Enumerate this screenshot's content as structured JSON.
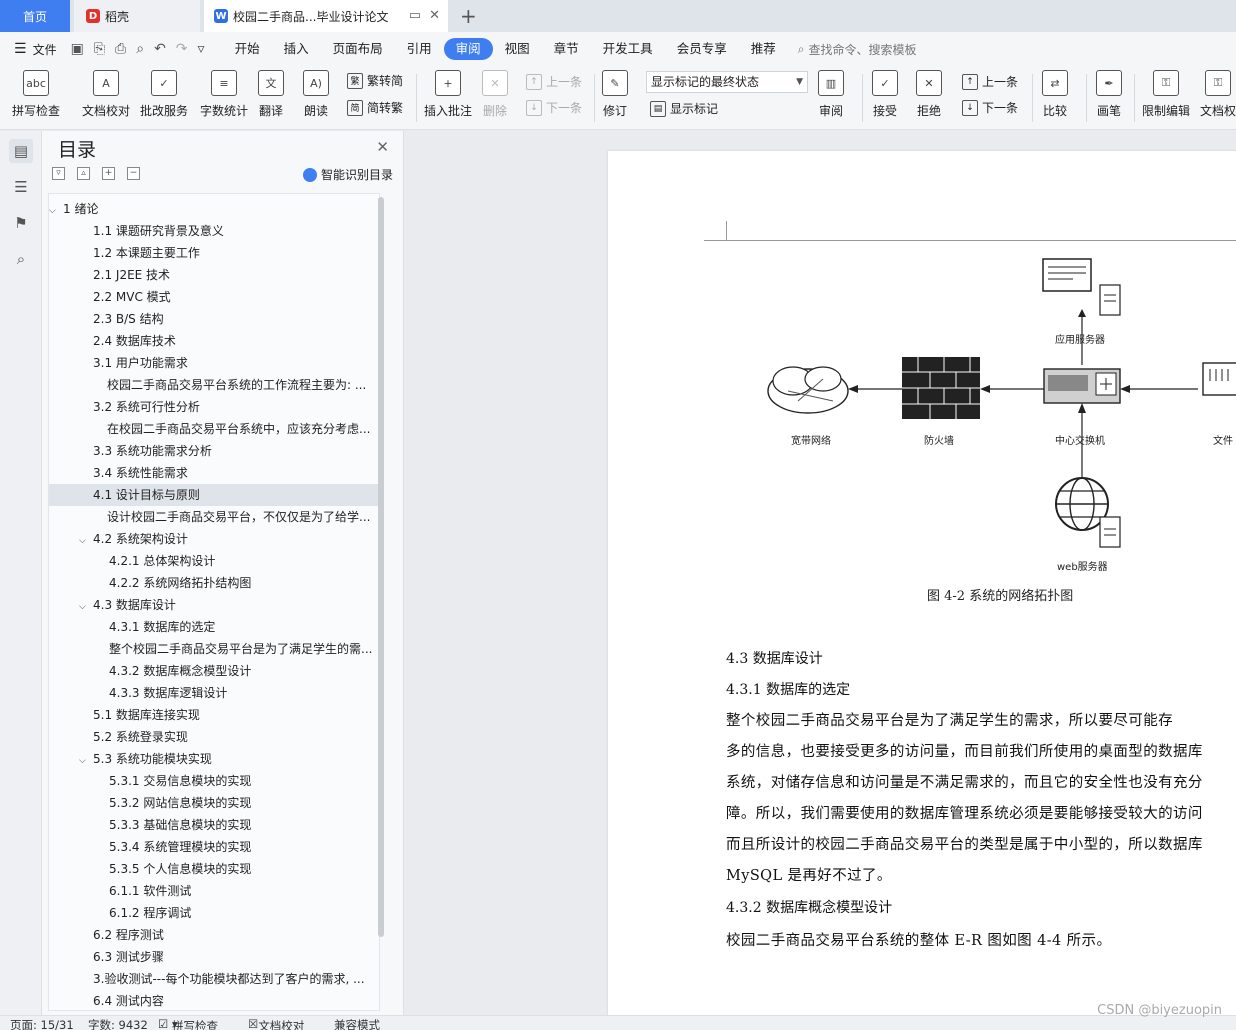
{
  "tabs": {
    "home": "首页",
    "doc1": "稻壳",
    "doc2": "校园二手商品...毕业设计论文",
    "doc2_icon": "W",
    "doc1_icon": "D"
  },
  "menubar": {
    "file": "文件",
    "tabs": [
      "开始",
      "插入",
      "页面布局",
      "引用",
      "审阅",
      "视图",
      "章节",
      "开发工具",
      "会员专享",
      "推荐"
    ],
    "search": "查找命令、搜索模板"
  },
  "ribbon": {
    "spell_check": "拼写检查",
    "doc_proof": "文档校对",
    "batch_service": "批改服务",
    "word_count": "字数统计",
    "translate": "翻译",
    "read_aloud": "朗读",
    "trad_to_simp": "繁转简",
    "simp_to_trad": "简转繁",
    "insert_comment": "插入批注",
    "delete": "删除",
    "prev_comment": "上一条",
    "next_comment": "下一条",
    "track_changes": "修订",
    "show_marks_select": "显示标记的最终状态",
    "show_marks": "显示标记",
    "review": "审阅",
    "accept": "接受",
    "reject": "拒绝",
    "prev_change": "上一条",
    "next_change": "下一条",
    "compare": "比较",
    "pen": "画笔",
    "restrict_edit": "限制编辑",
    "doc_perm": "文档权"
  },
  "toc": {
    "title": "目录",
    "smart": "智能识别目录",
    "items": [
      {
        "text": "1  绪论",
        "level": 0,
        "caret": "v"
      },
      {
        "text": "1.1  课题研究背景及意义",
        "level": 1
      },
      {
        "text": "1.2  本课题主要工作",
        "level": 1
      },
      {
        "text": "2.1  J2EE 技术",
        "level": 1
      },
      {
        "text": "2.2  MVC 模式",
        "level": 1
      },
      {
        "text": "2.3  B/S 结构",
        "level": 1
      },
      {
        "text": "2.4  数据库技术",
        "level": 1
      },
      {
        "text": "3.1  用户功能需求",
        "level": 1
      },
      {
        "text": "校园二手商品交易平台系统的工作流程主要为: ...",
        "level": 2
      },
      {
        "text": "3.2  系统可行性分析",
        "level": 1
      },
      {
        "text": "在校园二手商品交易平台系统中，应该充分考虑...",
        "level": 2
      },
      {
        "text": "3.3  系统功能需求分析",
        "level": 1
      },
      {
        "text": "3.4  系统性能需求",
        "level": 1
      },
      {
        "text": "4.1  设计目标与原则",
        "level": 1,
        "selected": true
      },
      {
        "text": "设计校园二手商品交易平台，不仅仅是为了给学...",
        "level": 2
      },
      {
        "text": "4.2  系统架构设计",
        "level": 1,
        "caret": "v"
      },
      {
        "text": "4.2.1  总体架构设计",
        "level": 3
      },
      {
        "text": "4.2.2  系统网络拓扑结构图",
        "level": 3
      },
      {
        "text": "4.3  数据库设计",
        "level": 1,
        "caret": "v"
      },
      {
        "text": "4.3.1  数据库的选定",
        "level": 3
      },
      {
        "text": "整个校园二手商品交易平台是为了满足学生的需...",
        "level": 3
      },
      {
        "text": "4.3.2  数据库概念模型设计",
        "level": 3
      },
      {
        "text": "4.3.3  数据库逻辑设计",
        "level": 3
      },
      {
        "text": "5.1  数据库连接实现",
        "level": 1
      },
      {
        "text": "5.2  系统登录实现",
        "level": 1
      },
      {
        "text": "5.3  系统功能模块实现",
        "level": 1,
        "caret": "v"
      },
      {
        "text": "5.3.1  交易信息模块的实现",
        "level": 3
      },
      {
        "text": "5.3.2  网站信息模块的实现",
        "level": 3
      },
      {
        "text": "5.3.3  基础信息模块的实现",
        "level": 3
      },
      {
        "text": "5.3.4  系统管理模块的实现",
        "level": 3
      },
      {
        "text": "5.3.5  个人信息模块的实现",
        "level": 3
      },
      {
        "text": "6.1.1  软件测试",
        "level": 3
      },
      {
        "text": "6.1.2  程序调试",
        "level": 3
      },
      {
        "text": "6.2  程序测试",
        "level": 1
      },
      {
        "text": "6.3  测试步骤",
        "level": 1
      },
      {
        "text": "3.验收测试---每个功能模块都达到了客户的需求, ...",
        "level": 1
      },
      {
        "text": "6.4  测试内容",
        "level": 1
      }
    ]
  },
  "figure": {
    "app_server": "应用服务器",
    "broadband": "宽带网络",
    "firewall": "防火墙",
    "core_switch": "中心交换机",
    "file_partial": "文件",
    "web_server": "web服务器",
    "caption": "图 4-2 系统的网络拓扑图"
  },
  "document": {
    "h_43": "4.3   数据库设计",
    "h_431": "4.3.1   数据库的选定",
    "p1_lines": [
      "    整个校园二手商品交易平台是为了满足学生的需求，所以要尽可能存",
      "多的信息，也要接受更多的访问量，而目前我们所使用的桌面型的数据库",
      "系统，对储存信息和访问量是不满足需求的，而且它的安全性也没有充分",
      "障。所以，我们需要使用的数据库管理系统必须是要能够接受较大的访问",
      "而且所设计的校园二手商品交易平台的类型是属于中小型的，所以数据库",
      "MySQL 是再好不过了。"
    ],
    "h_432": "4.3.2   数据库概念模型设计",
    "p2": "    校园二手商品交易平台系统的整体 E-R 图如图 4-4 所示。"
  },
  "status": {
    "page": "页面: 15/31",
    "words": "字数: 9432",
    "spell": "拼写检查",
    "proof": "文档校对",
    "compat": "兼容模式"
  },
  "watermark": "CSDN @biyezuopin",
  "colors": {
    "accent": "#3f7ef0",
    "selected_row": "#dfe3ea"
  }
}
